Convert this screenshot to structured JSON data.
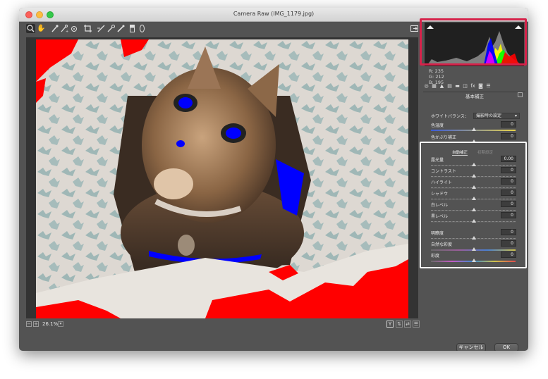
{
  "window": {
    "title": "Camera Raw (IMG_1179.jpg)"
  },
  "toolbar": {
    "tools": [
      "zoom-icon",
      "hand-icon",
      "white-balance-icon",
      "color-sampler-icon",
      "target-adjust-icon",
      "crop-icon",
      "straighten-icon",
      "spot-removal-icon",
      "red-eye-icon",
      "adjustment-brush-icon",
      "graduated-filter-icon",
      "radial-filter-icon"
    ],
    "fullscreen_icon": "open-panel-icon"
  },
  "canvas": {
    "zoom_level": "26.1%",
    "zoom_minus": "−",
    "zoom_plus": "+",
    "dropdown_glyph": "▾",
    "y_button": "Y"
  },
  "histogram": {
    "r_label": "R:",
    "r_value": "235",
    "g_label": "G:",
    "g_value": "212",
    "b_label": "B:",
    "b_value": "195"
  },
  "panel": {
    "section_title": "基本補正",
    "white_balance_label": "ホワイトバランス：",
    "white_balance_value": "撮影時の設定",
    "temperature": {
      "label": "色温度",
      "value": "0"
    },
    "tint": {
      "label": "色かぶり補正",
      "value": "0"
    },
    "tab_auto": "自動補正",
    "tab_default": "初期設定",
    "exposure": {
      "label": "露光量",
      "value": "0.00"
    },
    "contrast": {
      "label": "コントラスト",
      "value": "0"
    },
    "highlights": {
      "label": "ハイライト",
      "value": "0"
    },
    "shadows": {
      "label": "シャドウ",
      "value": "0"
    },
    "whites": {
      "label": "白レベル",
      "value": "0"
    },
    "blacks": {
      "label": "黒レベル",
      "value": "0"
    },
    "clarity": {
      "label": "明瞭度",
      "value": "0"
    },
    "vibrance": {
      "label": "自然な彩度",
      "value": "0"
    },
    "saturation": {
      "label": "彩度",
      "value": "0"
    }
  },
  "buttons": {
    "cancel": "キャンセル",
    "ok": "OK"
  },
  "colors": {
    "highlight_red": "#d6224a",
    "highlight_white": "#ffffff",
    "clip_red": "#ff0000",
    "clip_blue": "#0000ff"
  }
}
